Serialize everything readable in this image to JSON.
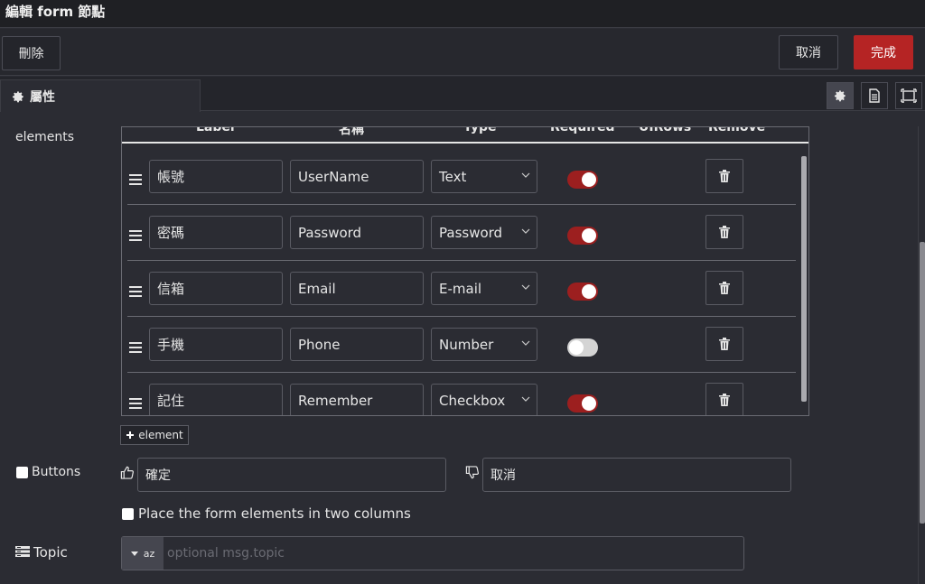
{
  "window": {
    "title": "編輯 form 節點"
  },
  "toolbar": {
    "delete_label": "刪除",
    "cancel_label": "取消",
    "done_label": "完成",
    "done_color": "#b52424"
  },
  "tabs": {
    "properties_label": "屬性",
    "icons": [
      "gear-icon",
      "description-icon",
      "appearance-icon"
    ]
  },
  "elements": {
    "label": "elements",
    "columns": [
      "Label",
      "名稱",
      "Type",
      "Required",
      "UIRows",
      "Remove"
    ],
    "rows": [
      {
        "label": "帳號",
        "name": "UserName",
        "type": "Text",
        "required": true
      },
      {
        "label": "密碼",
        "name": "Password",
        "type": "Password",
        "required": true
      },
      {
        "label": "信箱",
        "name": "Email",
        "type": "E-mail",
        "required": true
      },
      {
        "label": "手機",
        "name": "Phone",
        "type": "Number",
        "required": false
      },
      {
        "label": "記住",
        "name": "Remember",
        "type": "Checkbox",
        "required": true
      }
    ],
    "add_label": "element"
  },
  "buttons": {
    "label": "Buttons",
    "submit_value": "確定",
    "cancel_value": "取消"
  },
  "two_columns_label": "Place the form elements in two columns",
  "topic": {
    "label": "Topic",
    "type_label": "az",
    "placeholder": "optional msg.topic"
  }
}
